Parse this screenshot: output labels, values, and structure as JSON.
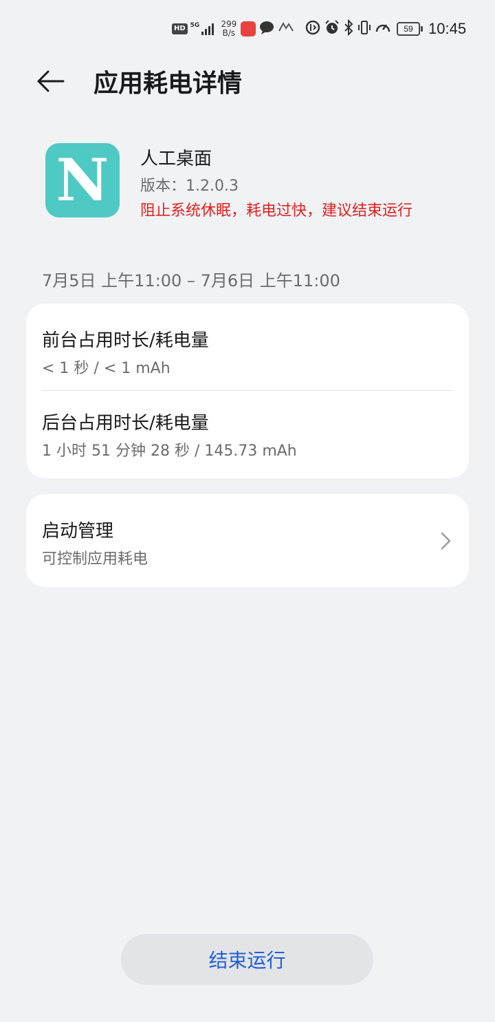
{
  "status_bar": {
    "hd_badge": "HD",
    "network": "5G",
    "speed_value": "299",
    "speed_unit": "B/s",
    "battery_level": "59",
    "time": "10:45"
  },
  "header": {
    "back_icon": "arrow-left-icon",
    "title": "应用耗电详情"
  },
  "app": {
    "icon_letter": "N",
    "icon_color": "#4ec9c4",
    "name": "人工桌面",
    "version_label": "版本：1.2.0.3",
    "warning": "阻止系统休眠，耗电过快，建议结束运行",
    "warning_color": "#e02020"
  },
  "date_range": "7月5日 上午11:00 – 7月6日 上午11:00",
  "usage": {
    "foreground_title": "前台占用时长/耗电量",
    "foreground_value": "< 1 秒 / < 1 mAh",
    "background_title": "后台占用时长/耗电量",
    "background_value": "1 小时 51 分钟 28 秒 / 145.73 mAh"
  },
  "launch": {
    "title": "启动管理",
    "subtitle": "可控制应用耗电",
    "chevron_icon": "chevron-right-icon"
  },
  "end_button": {
    "label": "结束运行",
    "color": "#1f5fd6"
  }
}
